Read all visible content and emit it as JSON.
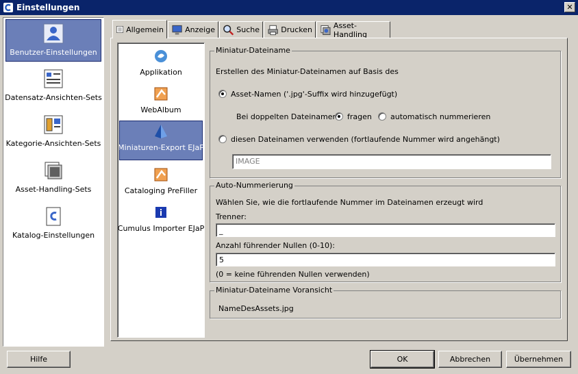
{
  "window": {
    "title": "Einstellungen",
    "close_glyph": "✕"
  },
  "sidebar": {
    "items": [
      {
        "label": "Benutzer-Einstellungen",
        "icon": "user-settings-icon",
        "selected": true
      },
      {
        "label": "Datensatz-Ansichten-Sets",
        "icon": "record-view-icon",
        "selected": false
      },
      {
        "label": "Kategorie-Ansichten-Sets",
        "icon": "category-view-icon",
        "selected": false
      },
      {
        "label": "Asset-Handling-Sets",
        "icon": "asset-handling-icon",
        "selected": false
      },
      {
        "label": "Katalog-Einstellungen",
        "icon": "catalog-settings-icon",
        "selected": false
      }
    ]
  },
  "tabs": [
    {
      "label": "Allgemein",
      "icon": "general-icon",
      "active": true
    },
    {
      "label": "Anzeige",
      "icon": "monitor-icon",
      "active": false
    },
    {
      "label": "Suche",
      "icon": "magnifier-icon",
      "active": false
    },
    {
      "label": "Drucken",
      "icon": "printer-icon",
      "active": false
    },
    {
      "label": "Asset-Handling",
      "icon": "asset-handling-icon",
      "active": false
    }
  ],
  "sublist": {
    "items": [
      {
        "label": "Applikation",
        "icon": "application-icon",
        "selected": false
      },
      {
        "label": "WebAlbum",
        "icon": "webalbum-icon",
        "selected": false
      },
      {
        "label": "Miniaturen-Export EJaP",
        "icon": "pyramid-icon",
        "selected": true
      },
      {
        "label": "Cataloging PreFiller",
        "icon": "prefiller-icon",
        "selected": false
      },
      {
        "label": "Cumulus Importer EJaP",
        "icon": "info-icon",
        "selected": false
      }
    ]
  },
  "group1": {
    "legend": "Miniatur-Dateiname",
    "intro": "Erstellen des Miniatur-Dateinamen auf Basis des",
    "radio_asset": "Asset-Namen ('.jpg'-Suffix wird hinzugefügt)",
    "duplicates_label": "Bei doppelten Dateinamen:",
    "radio_ask": "fragen",
    "radio_auto": "automatisch nummerieren",
    "radio_custom": "diesen Dateinamen verwenden (fortlaufende Nummer wird angehängt)",
    "custom_value": "IMAGE"
  },
  "group2": {
    "legend": "Auto-Nummerierung",
    "intro": "Wählen Sie, wie die fortlaufende Nummer im Dateinamen erzeugt wird",
    "separator_label": "Trenner:",
    "separator_value": "_",
    "zeros_label": "Anzahl führender Nullen (0-10):",
    "zeros_value": "5",
    "zeros_hint": "(0 = keine führenden Nullen verwenden)"
  },
  "group3": {
    "legend": "Miniatur-Dateiname Voransicht",
    "preview": "NameDesAssets.jpg"
  },
  "buttons": {
    "help": "Hilfe",
    "ok": "OK",
    "cancel": "Abbrechen",
    "apply": "Übernehmen"
  }
}
